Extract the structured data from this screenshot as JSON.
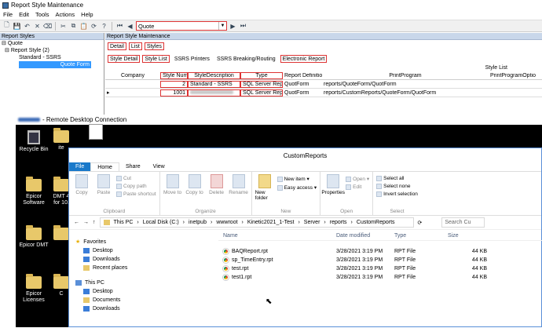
{
  "app": {
    "title": "Report Style Maintenance",
    "menu": [
      "File",
      "Edit",
      "Tools",
      "Actions",
      "Help"
    ],
    "combo_value": "Quote"
  },
  "left": {
    "header": "Report Styles",
    "tree": {
      "root": "Quote",
      "child": "Report Style (2)",
      "leaf1": "Standard - SSRS",
      "leaf2": "Quote Form"
    }
  },
  "right": {
    "header": "Report Style Maintenance",
    "tabs1": [
      "Detail",
      "List",
      "Styles"
    ],
    "tabs2": [
      "Style Detail",
      "Style List",
      "SSRS Printers",
      "SSRS Breaking/Routing",
      "Electronic Report"
    ],
    "grid_title": "Style List",
    "columns": [
      "Company",
      "Style Num",
      "StyleDescription",
      "Type",
      "Report Definitio",
      "PrintProgram",
      "PrintProgramOptio"
    ],
    "rows": [
      {
        "style_num": "2",
        "desc": "Standard - SSRS",
        "type": "SQL Server Rep",
        "report_def": "QuotForm",
        "print_program": "reports/QuoteForm/QuotForm"
      },
      {
        "style_num": "1001",
        "desc": "",
        "type": "SQL Server Rep",
        "report_def": "QuotForm",
        "print_program": "reports/CustomReports/QuoteForm/QuotForm"
      }
    ]
  },
  "rdp": {
    "title": "- Remote Desktop Connection",
    "desktop_icons": [
      "Recycle Bin",
      "Epicor Software",
      "Epicor DMT",
      "Epicor Licenses"
    ],
    "partial_labels": [
      "ite",
      "DMT 4 for 10.",
      "C"
    ]
  },
  "explorer": {
    "title": "CustomReports",
    "ribbon_tabs": [
      "File",
      "Home",
      "Share",
      "View"
    ],
    "clipboard": {
      "copy": "Copy",
      "paste": "Paste",
      "cut": "Cut",
      "copy_path": "Copy path",
      "paste_shortcut": "Paste shortcut",
      "label": "Clipboard"
    },
    "organize": {
      "move_to": "Move to",
      "copy_to": "Copy to",
      "delete": "Delete",
      "rename": "Rename",
      "label": "Organize"
    },
    "new": {
      "new_folder": "New folder",
      "new_item": "New item",
      "easy_access": "Easy access",
      "label": "New"
    },
    "open": {
      "properties": "Properties",
      "open": "Open",
      "edit": "Edit",
      "label": "Open"
    },
    "select": {
      "select_all": "Select all",
      "select_none": "Select none",
      "invert": "Invert selection",
      "label": "Select"
    },
    "breadcrumb": [
      "This PC",
      "Local Disk (C:)",
      "inetpub",
      "wwwroot",
      "Kinetic2021_1-Test",
      "Server",
      "reports",
      "CustomReports"
    ],
    "search_placeholder": "Search Cu",
    "nav": [
      "Favorites",
      "Desktop",
      "Downloads",
      "Recent places",
      "This PC",
      "Desktop",
      "Documents",
      "Downloads"
    ],
    "columns": [
      "Name",
      "Date modified",
      "Type",
      "Size"
    ],
    "files": [
      {
        "name": "BAQReport.rpt",
        "date": "3/28/2021 3:19 PM",
        "type": "RPT File",
        "size": "44 KB"
      },
      {
        "name": "sp_TimeEntry.rpt",
        "date": "3/28/2021 3:19 PM",
        "type": "RPT File",
        "size": "44 KB"
      },
      {
        "name": "test.rpt",
        "date": "3/28/2021 3:19 PM",
        "type": "RPT File",
        "size": "44 KB"
      },
      {
        "name": "test1.rpt",
        "date": "3/28/2021 3:19 PM",
        "type": "RPT File",
        "size": "44 KB"
      }
    ]
  }
}
